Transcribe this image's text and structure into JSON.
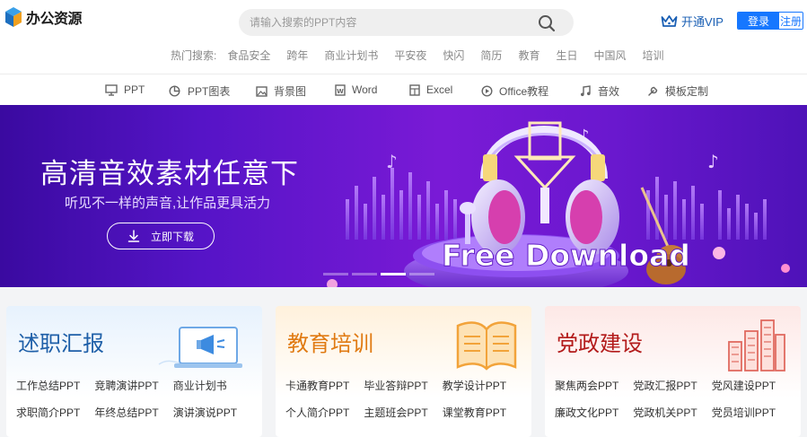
{
  "logo": {
    "text": "办公资源"
  },
  "search": {
    "placeholder": "请输入搜索的PPT内容",
    "value": ""
  },
  "header": {
    "vip_label": "开通VIP",
    "login_label": "登录",
    "register_label": "注册"
  },
  "hot_search": {
    "label": "热门搜索:",
    "items": [
      "食品安全",
      "跨年",
      "商业计划书",
      "平安夜",
      "快闪",
      "简历",
      "教育",
      "生日",
      "中国风",
      "培训"
    ]
  },
  "nav": {
    "items": [
      {
        "label": "PPT",
        "icon": "presentation-icon"
      },
      {
        "label": "PPT图表",
        "icon": "pie-chart-icon"
      },
      {
        "label": "背景图",
        "icon": "image-icon"
      },
      {
        "label": "Word",
        "icon": "word-icon"
      },
      {
        "label": "Excel",
        "icon": "excel-icon"
      },
      {
        "label": "Office教程",
        "icon": "play-icon"
      },
      {
        "label": "音效",
        "icon": "music-note-icon"
      },
      {
        "label": "模板定制",
        "icon": "wrench-icon"
      }
    ]
  },
  "banner": {
    "title": "高清音效素材任意下",
    "subtitle": "听见不一样的声音,让作品更具活力",
    "button_label": "立即下载",
    "art_text": "Free Download",
    "slide_count": 4,
    "active_slide": 3
  },
  "categories": [
    {
      "title": "述职汇报",
      "links": [
        "工作总结PPT",
        "竞聘演讲PPT",
        "商业计划书",
        "求职简介PPT",
        "年终总结PPT",
        "演讲演说PPT"
      ]
    },
    {
      "title": "教育培训",
      "links": [
        "卡通教育PPT",
        "毕业答辩PPT",
        "教学设计PPT",
        "个人简介PPT",
        "主题班会PPT",
        "课堂教育PPT"
      ]
    },
    {
      "title": "党政建设",
      "links": [
        "聚焦两会PPT",
        "党政汇报PPT",
        "党风建设PPT",
        "廉政文化PPT",
        "党政机关PPT",
        "党员培训PPT"
      ]
    }
  ],
  "colors": {
    "brand_blue": "#1677ff",
    "banner_purple": "#5614c7",
    "card_blue": "#1e5fa8",
    "card_orange": "#e07a12",
    "card_red": "#b31b1b"
  }
}
